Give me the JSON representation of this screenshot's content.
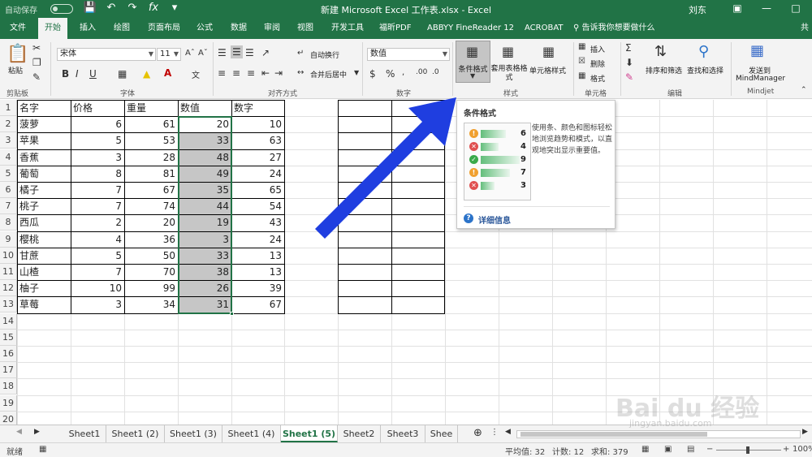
{
  "window": {
    "autosave_label": "自动保存",
    "title": "新建 Microsoft Excel 工作表.xlsx  -  Excel",
    "user": "刘东",
    "qat_icons": [
      "save-icon",
      "undo-icon",
      "redo-icon",
      "fx-icon"
    ]
  },
  "tabs": [
    "文件",
    "开始",
    "插入",
    "绘图",
    "页面布局",
    "公式",
    "数据",
    "审阅",
    "视图",
    "开发工具",
    "福昕PDF",
    "ABBYY FineReader 12",
    "ACROBAT"
  ],
  "active_tab": "开始",
  "tell_me": "告诉我你想要做什么",
  "share": "共",
  "ribbon": {
    "paste": "粘贴",
    "clipboard": "剪贴板",
    "font_name": "宋体",
    "font_size": "11",
    "font_group": "字体",
    "wrap_text": "自动换行",
    "merge_center": "合并后居中",
    "alignment_group": "对齐方式",
    "number_format": "数值",
    "number_group": "数字",
    "conditional_format": "条件格式",
    "format_as_table": "套用表格格式",
    "cell_styles": "单元格样式",
    "styles_group": "样式",
    "insert": "插入",
    "delete": "删除",
    "format": "格式",
    "cells_group": "单元格",
    "sort_filter": "排序和筛选",
    "find_select": "查找和选择",
    "editing_group": "编辑",
    "send_to": "发送到",
    "mindmanager": "MindManager",
    "mindjet_group": "Mindjet",
    "bold": "B",
    "italic": "I",
    "underline": "U"
  },
  "sheet": {
    "headers": [
      "名字",
      "价格",
      "重量",
      "数值",
      "数字"
    ],
    "rows": [
      [
        "菠萝",
        "6",
        "61",
        "20",
        "10"
      ],
      [
        "苹果",
        "5",
        "53",
        "33",
        "63"
      ],
      [
        "香蕉",
        "3",
        "28",
        "48",
        "27"
      ],
      [
        "葡萄",
        "8",
        "81",
        "49",
        "24"
      ],
      [
        "橘子",
        "7",
        "67",
        "35",
        "65"
      ],
      [
        "桃子",
        "7",
        "74",
        "44",
        "54"
      ],
      [
        "西瓜",
        "2",
        "20",
        "19",
        "43"
      ],
      [
        "樱桃",
        "4",
        "36",
        "3",
        "24"
      ],
      [
        "甘蔗",
        "5",
        "50",
        "33",
        "13"
      ],
      [
        "山楂",
        "7",
        "70",
        "38",
        "13"
      ],
      [
        "柚子",
        "10",
        "99",
        "26",
        "39"
      ],
      [
        "草莓",
        "3",
        "34",
        "31",
        "67"
      ]
    ],
    "row_numbers": [
      "1",
      "2",
      "3",
      "4",
      "5",
      "6",
      "7",
      "8",
      "9",
      "10",
      "11",
      "12",
      "13",
      "14",
      "15",
      "16",
      "17",
      "18",
      "19",
      "20"
    ]
  },
  "tooltip": {
    "title": "条件格式",
    "description": "使用条、颜色和图标轻松地浏览趋势和模式，以直观地突出显示重要值。",
    "help": "详细信息",
    "preview_values": [
      "6",
      "4",
      "9",
      "7",
      "3"
    ],
    "preview_fill": [
      0.55,
      0.4,
      0.85,
      0.65,
      0.3
    ],
    "preview_icons": [
      "#f0a030",
      "#e05050",
      "#3aa94a",
      "#f0a030",
      "#e05050"
    ]
  },
  "sheet_tabs": [
    "Sheet1",
    "Sheet1 (2)",
    "Sheet1 (3)",
    "Sheet1 (4)",
    "Sheet1 (5)",
    "Sheet2",
    "Sheet3",
    "Shee"
  ],
  "active_sheet": "Sheet1 (5)",
  "status": {
    "mode": "就绪",
    "average": "平均值: 32",
    "count": "计数: 12",
    "sum": "求和: 379",
    "zoom": "100%"
  },
  "watermark": {
    "main": "Bai du 经验",
    "sub": "jingyan.baidu.com"
  },
  "colors": {
    "excel_green": "#217346",
    "selection_fill": "#c6c6c6",
    "arrow": "#1f3ee0"
  }
}
